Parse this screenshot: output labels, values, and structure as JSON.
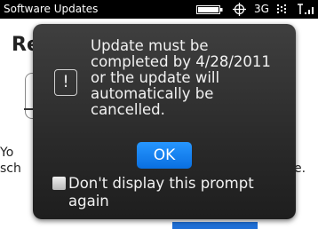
{
  "statusbar": {
    "title": "Software Updates",
    "network": "3G"
  },
  "background": {
    "heading_fragment": "Re",
    "text_line1_fragment": "Yo",
    "text_line2_fragment": "sch",
    "text_line2_end": "e."
  },
  "dialog": {
    "icon_glyph": "!",
    "message": "Update must be completed by 4/28/2011 or the update will automatically be cancelled.",
    "ok_label": "OK",
    "checkbox_label": "Don't display this prompt again",
    "checkbox_checked": false
  },
  "colors": {
    "accent": "#1478f0",
    "dialog_bg": "#2e2e2e",
    "statusbar_bg": "#000000"
  },
  "icons": [
    "battery-icon",
    "crosshair-icon",
    "transfer-icon",
    "signal-icon",
    "alert-icon"
  ]
}
